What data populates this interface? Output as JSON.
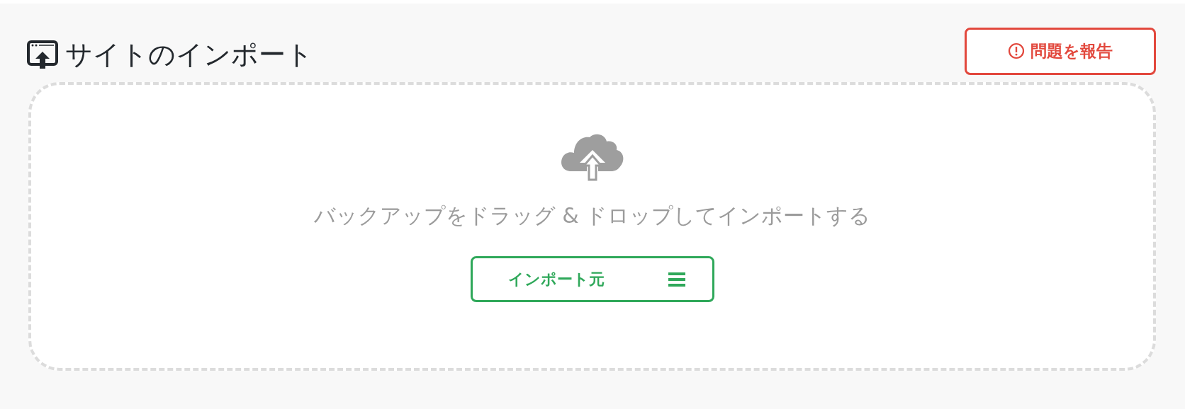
{
  "header": {
    "title": "サイトのインポート",
    "report_button": "問題を報告"
  },
  "dropzone": {
    "message": "バックアップをドラッグ & ドロップしてインポートする",
    "import_button": "インポート元"
  }
}
